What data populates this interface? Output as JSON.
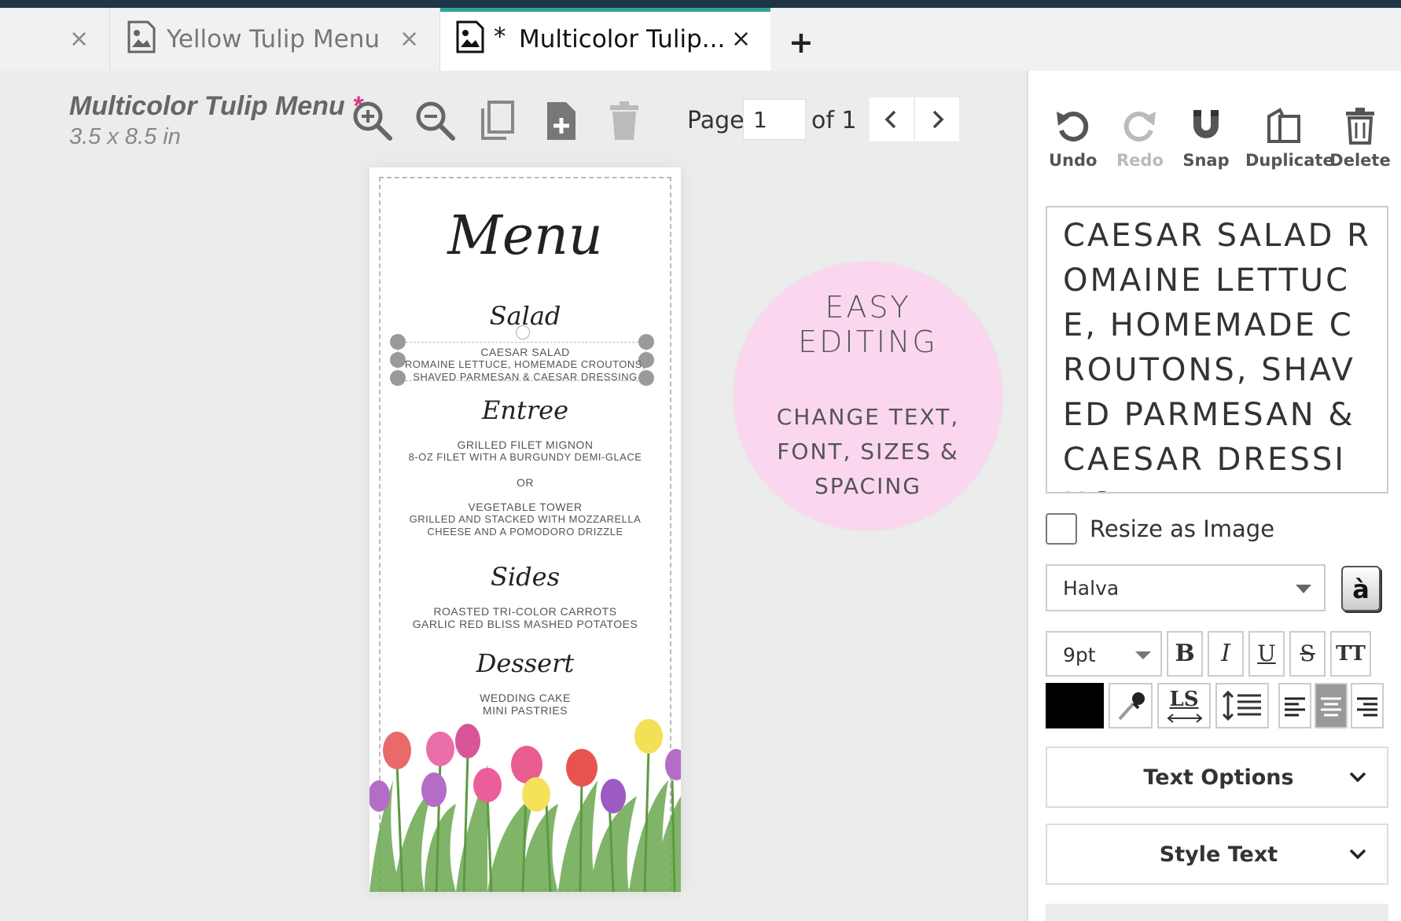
{
  "tabs": [
    {
      "label": "",
      "close": "×"
    },
    {
      "label": "Yellow Tulip Menu",
      "close": "×"
    },
    {
      "label": "Multicolor Tulip...",
      "modified": "*",
      "close": "×"
    }
  ],
  "add_tab": "+",
  "document": {
    "title": "Multicolor Tulip Menu",
    "modified_marker": "*",
    "size": "3.5 x 8.5 in"
  },
  "toolbar": {
    "icons": [
      "zoom-in-icon",
      "zoom-out-icon",
      "copy-page-icon",
      "add-page-icon",
      "delete-page-icon"
    ]
  },
  "pagination": {
    "label": "Page",
    "current": "1",
    "of_label": "of 1"
  },
  "menu": {
    "heading": "Menu",
    "sections": [
      {
        "title": "Salad",
        "lines": [
          "CAESAR SALAD",
          "ROMAINE LETTUCE, HOMEMADE CROUTONS,",
          "SHAVED PARMESAN & CAESAR DRESSING"
        ]
      },
      {
        "title": "Entree",
        "lines": [
          "GRILLED FILET MIGNON",
          "8-OZ FILET WITH A BURGUNDY DEMI-GLACE",
          "OR",
          "VEGETABLE TOWER",
          "GRILLED AND STACKED WITH MOZZARELLA",
          "CHEESE AND A POMODORO DRIZZLE"
        ]
      },
      {
        "title": "Sides",
        "lines": [
          "ROASTED TRI-COLOR CARROTS",
          "GARLIC RED BLISS MASHED POTATOES"
        ]
      },
      {
        "title": "Dessert",
        "lines": [
          "WEDDING CAKE",
          "MINI PASTRIES"
        ]
      }
    ]
  },
  "promo": {
    "title_line1": "EASY",
    "title_line2": "EDITING",
    "body_line1": "CHANGE TEXT,",
    "body_line2": "FONT, SIZES &",
    "body_line3": "SPACING",
    "color": "#fbd7ef"
  },
  "side_panel": {
    "tools": [
      {
        "label": "Undo",
        "icon": "undo-icon"
      },
      {
        "label": "Redo",
        "icon": "redo-icon"
      },
      {
        "label": "Snap",
        "icon": "magnet-icon"
      },
      {
        "label": "Duplicate",
        "icon": "duplicate-icon"
      },
      {
        "label": "Delete",
        "icon": "trash-icon"
      }
    ],
    "text_value": "CAESAR SALAD ROMAINE LETTUCE, HOMEMADE CROUTONS, SHAVED PARMESAN & CAESAR DRESSING",
    "resize_label": "Resize as Image",
    "font": "Halva",
    "accent_glyph": "à",
    "font_size": "9pt",
    "format_buttons": {
      "bold": "B",
      "italic": "I",
      "underline": "U",
      "strike": "S",
      "caps": "TT",
      "letter_spacing": "LS"
    },
    "text_color": "#000000",
    "accordions": [
      {
        "label": "Text Options"
      },
      {
        "label": "Style Text"
      }
    ]
  },
  "colors": {
    "accent": "#35a39a",
    "topbar": "#1d3547",
    "modified": "#e0368b"
  }
}
